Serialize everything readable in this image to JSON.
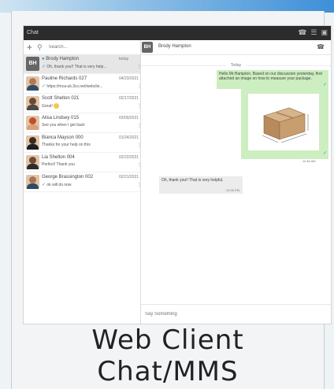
{
  "app": {
    "title": "Chat"
  },
  "search": {
    "placeholder": "Search..."
  },
  "conversations": [
    {
      "initials": "BH",
      "name": "Brody Hampton",
      "date": "today",
      "preview": "Oh, thank you!! That is very help...",
      "selected": true
    },
    {
      "name": "Pauline Richards 027",
      "date": "04/23/2021",
      "preview": "https://mca-uk.3cx.net/webclie..."
    },
    {
      "name": "Scott Shelton 021",
      "date": "02/17/2021",
      "preview": "Great! "
    },
    {
      "name": "Alisa Lindsey 015",
      "date": "03/09/2021",
      "preview": "See you when I get back"
    },
    {
      "name": "Bianca Mayson 000",
      "date": "01/24/2021",
      "preview": "Thanks for your help on this"
    },
    {
      "name": "Lia Shelton 004",
      "date": "02/22/2021",
      "preview": "Perfect! Thank you"
    },
    {
      "name": "George Brassington 002",
      "date": "02/21/2021",
      "preview": "ok will do now"
    }
  ],
  "chat": {
    "contact_initials": "BH",
    "contact_name": "Brody Hampton",
    "day_label": "Today",
    "outgoing_message": "Hello Mr.Hampton. Based on our discussion yesterday, find attached an image on how to measure your package.",
    "outgoing_time": "11:46 AM",
    "incoming_message": "Oh, thank you!! That is very helpful.",
    "incoming_time": "12:05 PM",
    "compose_placeholder": "Say Something"
  },
  "caption": {
    "line1": "Web Client",
    "line2": "Chat/MMS"
  },
  "colors": {
    "accent": "#3e8fd8",
    "outgoing_bubble": "#cdeec0",
    "incoming_bubble": "#ececec",
    "titlebar": "#2c2c2c"
  }
}
